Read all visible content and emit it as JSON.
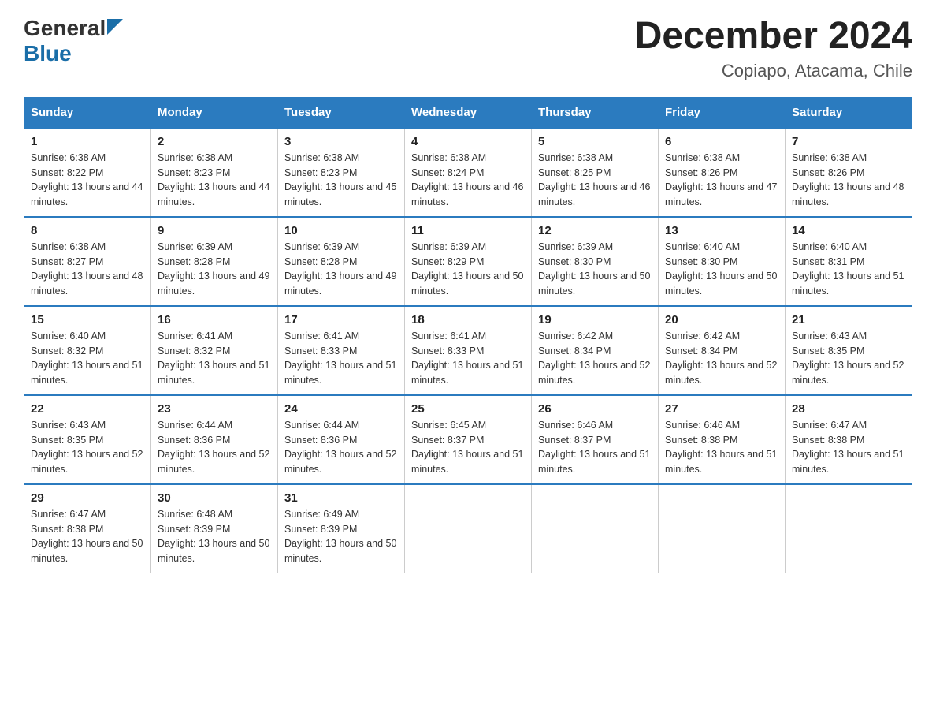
{
  "header": {
    "logo_general": "General",
    "logo_blue": "Blue",
    "month_title": "December 2024",
    "location": "Copiapo, Atacama, Chile"
  },
  "weekdays": [
    "Sunday",
    "Monday",
    "Tuesday",
    "Wednesday",
    "Thursday",
    "Friday",
    "Saturday"
  ],
  "weeks": [
    [
      {
        "day": "1",
        "sunrise": "6:38 AM",
        "sunset": "8:22 PM",
        "daylight": "13 hours and 44 minutes."
      },
      {
        "day": "2",
        "sunrise": "6:38 AM",
        "sunset": "8:23 PM",
        "daylight": "13 hours and 44 minutes."
      },
      {
        "day": "3",
        "sunrise": "6:38 AM",
        "sunset": "8:23 PM",
        "daylight": "13 hours and 45 minutes."
      },
      {
        "day": "4",
        "sunrise": "6:38 AM",
        "sunset": "8:24 PM",
        "daylight": "13 hours and 46 minutes."
      },
      {
        "day": "5",
        "sunrise": "6:38 AM",
        "sunset": "8:25 PM",
        "daylight": "13 hours and 46 minutes."
      },
      {
        "day": "6",
        "sunrise": "6:38 AM",
        "sunset": "8:26 PM",
        "daylight": "13 hours and 47 minutes."
      },
      {
        "day": "7",
        "sunrise": "6:38 AM",
        "sunset": "8:26 PM",
        "daylight": "13 hours and 48 minutes."
      }
    ],
    [
      {
        "day": "8",
        "sunrise": "6:38 AM",
        "sunset": "8:27 PM",
        "daylight": "13 hours and 48 minutes."
      },
      {
        "day": "9",
        "sunrise": "6:39 AM",
        "sunset": "8:28 PM",
        "daylight": "13 hours and 49 minutes."
      },
      {
        "day": "10",
        "sunrise": "6:39 AM",
        "sunset": "8:28 PM",
        "daylight": "13 hours and 49 minutes."
      },
      {
        "day": "11",
        "sunrise": "6:39 AM",
        "sunset": "8:29 PM",
        "daylight": "13 hours and 50 minutes."
      },
      {
        "day": "12",
        "sunrise": "6:39 AM",
        "sunset": "8:30 PM",
        "daylight": "13 hours and 50 minutes."
      },
      {
        "day": "13",
        "sunrise": "6:40 AM",
        "sunset": "8:30 PM",
        "daylight": "13 hours and 50 minutes."
      },
      {
        "day": "14",
        "sunrise": "6:40 AM",
        "sunset": "8:31 PM",
        "daylight": "13 hours and 51 minutes."
      }
    ],
    [
      {
        "day": "15",
        "sunrise": "6:40 AM",
        "sunset": "8:32 PM",
        "daylight": "13 hours and 51 minutes."
      },
      {
        "day": "16",
        "sunrise": "6:41 AM",
        "sunset": "8:32 PM",
        "daylight": "13 hours and 51 minutes."
      },
      {
        "day": "17",
        "sunrise": "6:41 AM",
        "sunset": "8:33 PM",
        "daylight": "13 hours and 51 minutes."
      },
      {
        "day": "18",
        "sunrise": "6:41 AM",
        "sunset": "8:33 PM",
        "daylight": "13 hours and 51 minutes."
      },
      {
        "day": "19",
        "sunrise": "6:42 AM",
        "sunset": "8:34 PM",
        "daylight": "13 hours and 52 minutes."
      },
      {
        "day": "20",
        "sunrise": "6:42 AM",
        "sunset": "8:34 PM",
        "daylight": "13 hours and 52 minutes."
      },
      {
        "day": "21",
        "sunrise": "6:43 AM",
        "sunset": "8:35 PM",
        "daylight": "13 hours and 52 minutes."
      }
    ],
    [
      {
        "day": "22",
        "sunrise": "6:43 AM",
        "sunset": "8:35 PM",
        "daylight": "13 hours and 52 minutes."
      },
      {
        "day": "23",
        "sunrise": "6:44 AM",
        "sunset": "8:36 PM",
        "daylight": "13 hours and 52 minutes."
      },
      {
        "day": "24",
        "sunrise": "6:44 AM",
        "sunset": "8:36 PM",
        "daylight": "13 hours and 52 minutes."
      },
      {
        "day": "25",
        "sunrise": "6:45 AM",
        "sunset": "8:37 PM",
        "daylight": "13 hours and 51 minutes."
      },
      {
        "day": "26",
        "sunrise": "6:46 AM",
        "sunset": "8:37 PM",
        "daylight": "13 hours and 51 minutes."
      },
      {
        "day": "27",
        "sunrise": "6:46 AM",
        "sunset": "8:38 PM",
        "daylight": "13 hours and 51 minutes."
      },
      {
        "day": "28",
        "sunrise": "6:47 AM",
        "sunset": "8:38 PM",
        "daylight": "13 hours and 51 minutes."
      }
    ],
    [
      {
        "day": "29",
        "sunrise": "6:47 AM",
        "sunset": "8:38 PM",
        "daylight": "13 hours and 50 minutes."
      },
      {
        "day": "30",
        "sunrise": "6:48 AM",
        "sunset": "8:39 PM",
        "daylight": "13 hours and 50 minutes."
      },
      {
        "day": "31",
        "sunrise": "6:49 AM",
        "sunset": "8:39 PM",
        "daylight": "13 hours and 50 minutes."
      },
      null,
      null,
      null,
      null
    ]
  ]
}
